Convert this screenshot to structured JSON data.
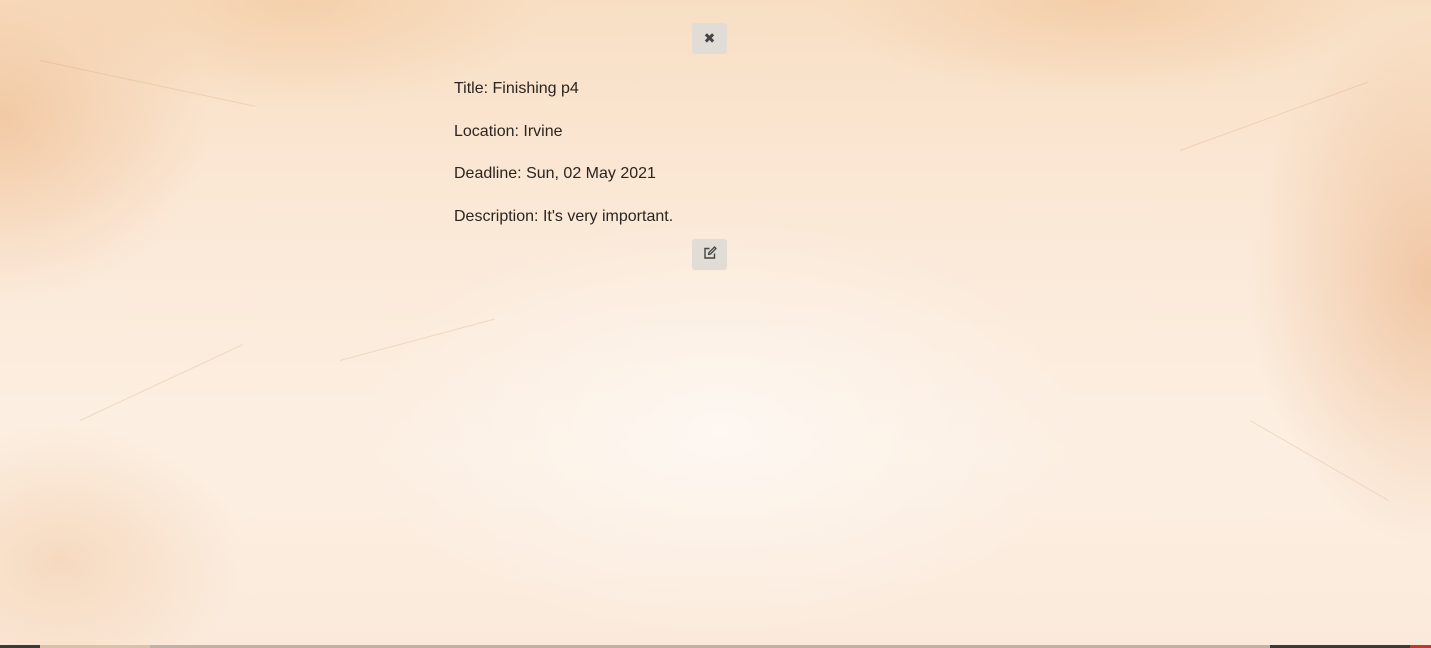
{
  "close_button": {
    "icon": "close-icon"
  },
  "edit_button": {
    "icon": "edit-icon"
  },
  "details": {
    "title_label": "Title:",
    "title_value": "Finishing p4",
    "location_label": "Location:",
    "location_value": "Irvine",
    "deadline_label": "Deadline:",
    "deadline_value": "Sun, 02 May 2021",
    "description_label": "Description:",
    "description_value": "It's very important."
  },
  "colors": {
    "background": "#fbe9d8",
    "button_bg": "#e1dcd6",
    "text": "#2b2420"
  }
}
